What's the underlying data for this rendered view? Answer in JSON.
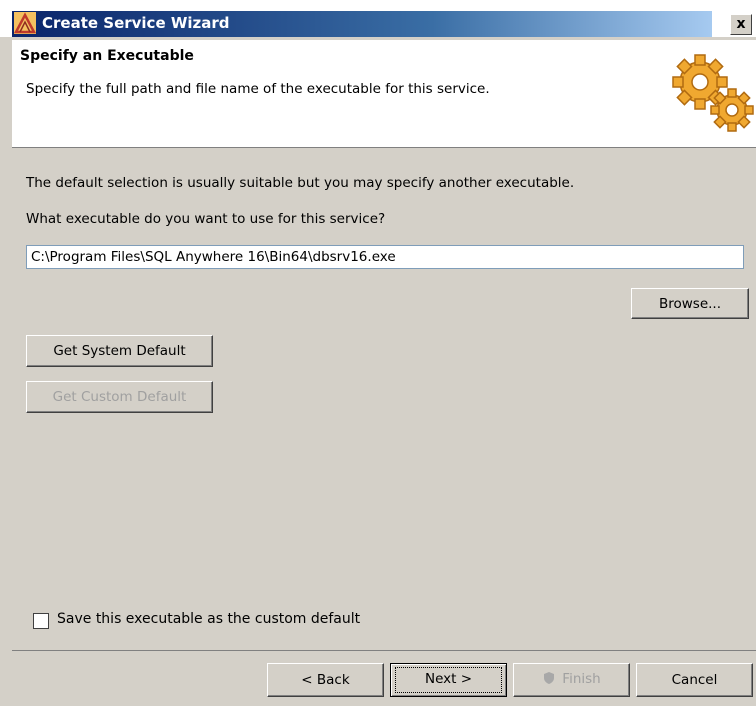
{
  "window": {
    "title": "Create Service Wizard",
    "close_label": "x"
  },
  "header": {
    "title": "Specify an Executable",
    "subtitle": "Specify the full path and file name of the executable for this service."
  },
  "main": {
    "description": "The default selection is usually suitable but you may specify another executable.",
    "question": "What executable do you want to use for this service?",
    "executable_path": "C:\\Program Files\\SQL Anywhere 16\\Bin64\\dbsrv16.exe",
    "browse_label": "Browse...",
    "system_default_label": "Get System Default",
    "custom_default_label": "Get Custom Default",
    "save_custom_label": "Save this executable as the custom default",
    "save_custom_checked": false
  },
  "footer": {
    "back_label": "< Back",
    "next_label": "Next >",
    "finish_label": "Finish",
    "cancel_label": "Cancel"
  },
  "colors": {
    "title_bar": "#0a246a",
    "dialog_bg": "#d4d0c8",
    "gear": "#f0a830"
  }
}
